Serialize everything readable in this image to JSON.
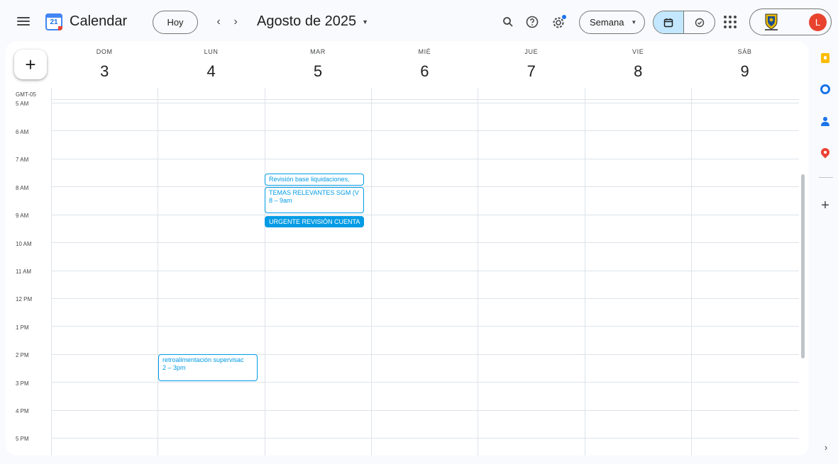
{
  "header": {
    "menu_icon": "hamburger-menu-icon",
    "logo_number": "21",
    "app_title": "Calendar",
    "today_label": "Hoy",
    "prev_label": "‹",
    "next_label": "›",
    "period_label": "Agosto de 2025",
    "period_caret": "▼",
    "view_label": "Semana",
    "view_caret": "▼",
    "avatar_letter": "L",
    "icons": [
      "search-icon",
      "help-icon",
      "settings-icon",
      "calendar-view-icon",
      "tasks-view-icon",
      "apps-grid-icon"
    ],
    "accent_color": "#c2e7ff"
  },
  "calendar": {
    "create_label": "+",
    "timezone": "GMT-05",
    "days": [
      {
        "dow": "DOM",
        "num": "3"
      },
      {
        "dow": "LUN",
        "num": "4"
      },
      {
        "dow": "MAR",
        "num": "5"
      },
      {
        "dow": "MIÉ",
        "num": "6"
      },
      {
        "dow": "JUE",
        "num": "7"
      },
      {
        "dow": "VIE",
        "num": "8"
      },
      {
        "dow": "SÁB",
        "num": "9"
      }
    ],
    "hours": [
      "5 AM",
      "6 AM",
      "7 AM",
      "8 AM",
      "9 AM",
      "10 AM",
      "11 AM",
      "12 PM",
      "1 PM",
      "2 PM",
      "3 PM",
      "4 PM",
      "5 PM"
    ],
    "events": [
      {
        "title": "Revisión base liquidaciones,",
        "time": "",
        "style": "outline"
      },
      {
        "title": "TEMAS RELEVANTES SGM (V",
        "time": "8 – 9am",
        "style": "outline"
      },
      {
        "title": "URGENTE REVISIÓN CUENTA",
        "time": "",
        "style": "filled"
      },
      {
        "title": "retroalimentación supervisac",
        "time": "2 – 3pm",
        "style": "outline"
      }
    ],
    "event_color": "#039be5"
  },
  "side_panel": {
    "icons": [
      "keep-icon",
      "tasks-icon",
      "contacts-icon",
      "maps-icon"
    ],
    "add_label": "+",
    "expand_label": "›"
  }
}
